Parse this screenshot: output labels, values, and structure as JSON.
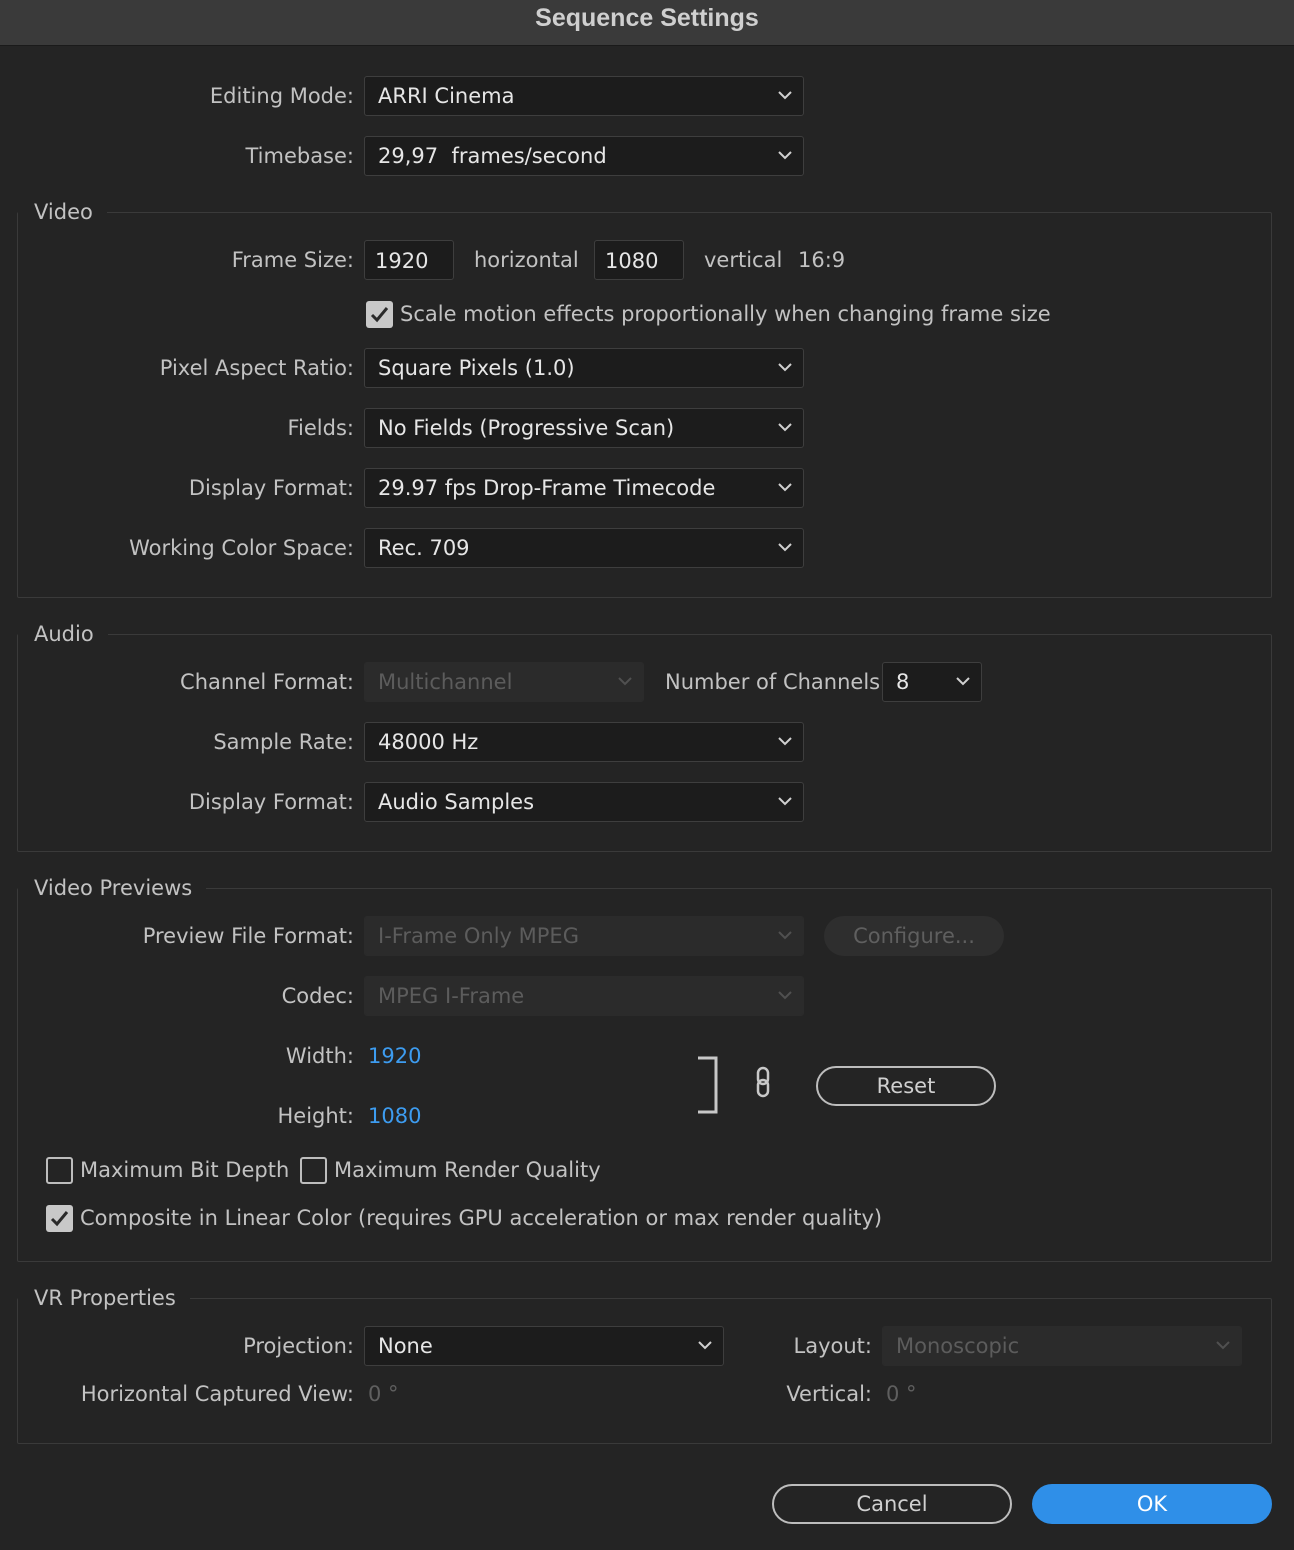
{
  "window": {
    "title": "Sequence Settings"
  },
  "general": {
    "editing_mode": {
      "label": "Editing Mode:",
      "value": "ARRI Cinema"
    },
    "timebase": {
      "label": "Timebase:",
      "value": "29,97  frames/second"
    }
  },
  "video": {
    "legend": "Video",
    "frame_size": {
      "label": "Frame Size:",
      "width": "1920",
      "horizontal_label": "horizontal",
      "height": "1080",
      "vertical_label": "vertical",
      "aspect": "16:9"
    },
    "scale_motion": {
      "label": "Scale motion effects proportionally when changing frame size",
      "checked": true
    },
    "pixel_aspect_ratio": {
      "label": "Pixel Aspect Ratio:",
      "value": "Square Pixels (1.0)"
    },
    "fields": {
      "label": "Fields:",
      "value": "No Fields (Progressive Scan)"
    },
    "display_format": {
      "label": "Display Format:",
      "value": "29.97 fps Drop-Frame Timecode"
    },
    "working_color_space": {
      "label": "Working Color Space:",
      "value": "Rec. 709"
    }
  },
  "audio": {
    "legend": "Audio",
    "channel_format": {
      "label": "Channel Format:",
      "value": "Multichannel"
    },
    "number_of_channels": {
      "label": "Number of Channels:",
      "value": "8"
    },
    "sample_rate": {
      "label": "Sample Rate:",
      "value": "48000 Hz"
    },
    "display_format": {
      "label": "Display Format:",
      "value": "Audio Samples"
    }
  },
  "video_previews": {
    "legend": "Video Previews",
    "preview_file_format": {
      "label": "Preview File Format:",
      "value": "I-Frame Only MPEG"
    },
    "configure_label": "Configure...",
    "codec": {
      "label": "Codec:",
      "value": "MPEG I-Frame"
    },
    "width": {
      "label": "Width:",
      "value": "1920"
    },
    "height": {
      "label": "Height:",
      "value": "1080"
    },
    "reset_label": "Reset",
    "max_bit_depth": {
      "label": "Maximum Bit Depth",
      "checked": false
    },
    "max_render_quality": {
      "label": "Maximum Render Quality",
      "checked": false
    },
    "composite_linear": {
      "label": "Composite in Linear Color (requires GPU acceleration or max render quality)",
      "checked": true
    }
  },
  "vr": {
    "legend": "VR Properties",
    "projection": {
      "label": "Projection:",
      "value": "None"
    },
    "layout": {
      "label": "Layout:",
      "value": "Monoscopic"
    },
    "horizontal_view": {
      "label": "Horizontal Captured View:",
      "value": "0 °"
    },
    "vertical": {
      "label": "Vertical:",
      "value": "0 °"
    }
  },
  "footer": {
    "cancel_label": "Cancel",
    "ok_label": "OK"
  },
  "colors": {
    "accent": "#2f8fe8",
    "link_value": "#3d9cf0",
    "background": "#242424"
  }
}
